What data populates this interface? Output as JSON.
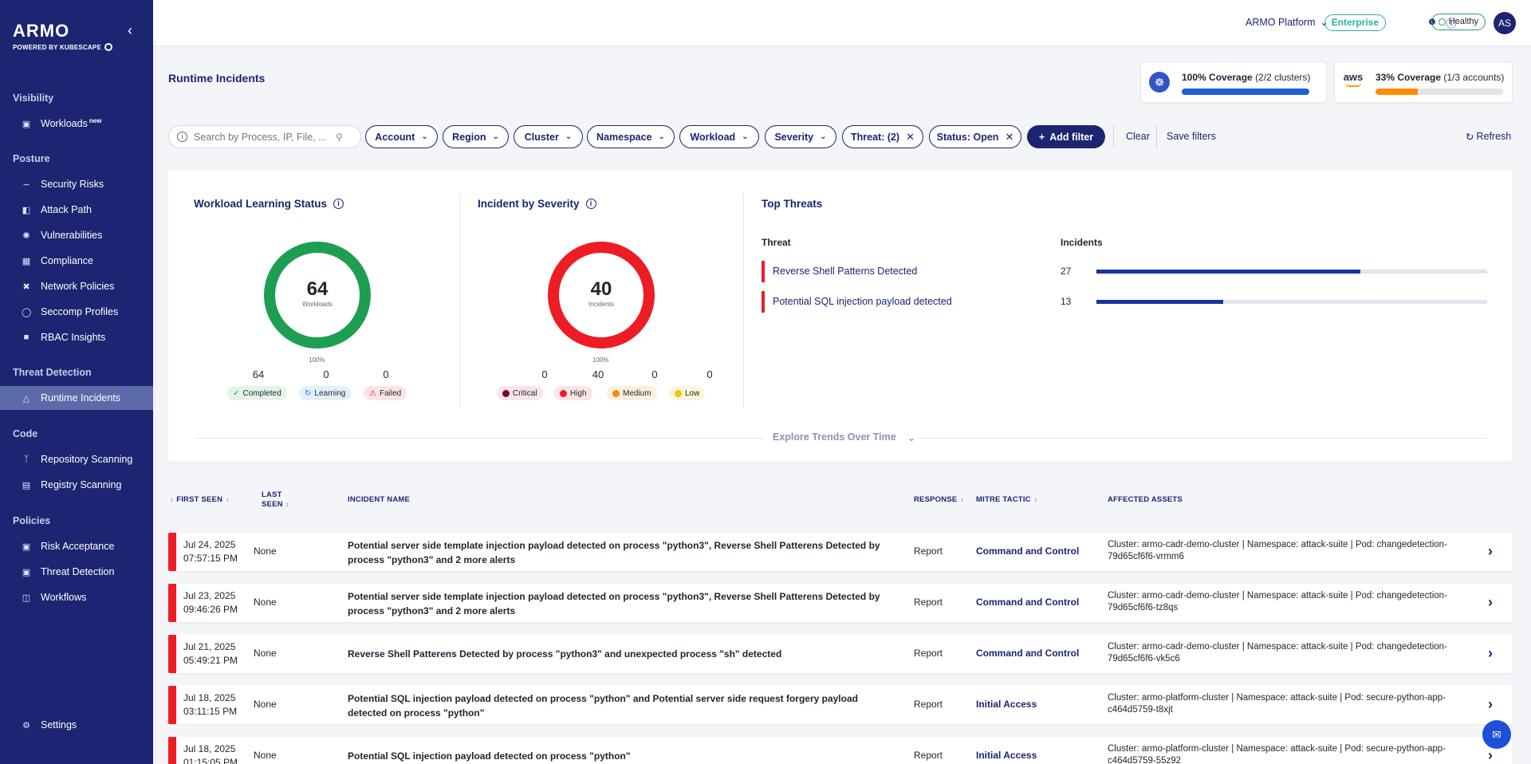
{
  "brand": {
    "name": "ARMO",
    "tagline": "POWERED BY KUBESCAPE"
  },
  "sidebar": {
    "sections": [
      {
        "title": "Visibility"
      },
      {
        "title": "Posture"
      },
      {
        "title": "Threat Detection"
      },
      {
        "title": "Code"
      },
      {
        "title": "Policies"
      }
    ],
    "items": [
      {
        "label": "Workloads",
        "badge": "new",
        "icon": "workloads-icon"
      },
      {
        "label": "Security Risks",
        "icon": "trend-icon"
      },
      {
        "label": "Attack Path",
        "icon": "path-icon"
      },
      {
        "label": "Vulnerabilities",
        "icon": "bug-icon"
      },
      {
        "label": "Compliance",
        "icon": "compliance-icon"
      },
      {
        "label": "Network Policies",
        "icon": "network-icon"
      },
      {
        "label": "Seccomp Profiles",
        "icon": "shield-icon"
      },
      {
        "label": "RBAC Insights",
        "icon": "rbac-icon"
      },
      {
        "label": "Runtime Incidents",
        "icon": "warning-icon",
        "active": true
      },
      {
        "label": "Repository Scanning",
        "icon": "branch-icon"
      },
      {
        "label": "Registry Scanning",
        "icon": "registry-icon"
      },
      {
        "label": "Risk Acceptance",
        "icon": "risk-icon"
      },
      {
        "label": "Threat Detection",
        "icon": "threat-icon"
      },
      {
        "label": "Workflows",
        "icon": "workflow-icon"
      },
      {
        "label": "Settings",
        "icon": "gear-icon"
      }
    ]
  },
  "topbar": {
    "platform": "ARMO Platform",
    "plan": "Enterprise",
    "status": "Healthy",
    "avatar": "AS"
  },
  "page": {
    "title": "Runtime Incidents"
  },
  "coverage": [
    {
      "percent_text": "100% Coverage",
      "detail": "(2/2 clusters)",
      "value": 1.0,
      "color": "#1e5ed8"
    },
    {
      "percent_text": "33% Coverage",
      "detail": "(1/3 accounts)",
      "value": 0.33,
      "color": "#ff8c00"
    }
  ],
  "filters": {
    "search_placeholder": "Search by Process, IP, File, ...",
    "chips": [
      "Account",
      "Region",
      "Cluster",
      "Namespace",
      "Workload",
      "Severity"
    ],
    "active_chips": [
      "Threat: (2)",
      "Status: Open"
    ],
    "add_filter": "Add filter",
    "clear": "Clear",
    "save": "Save filters",
    "refresh": "Refresh"
  },
  "learning": {
    "title": "Workload Learning Status",
    "total": "64",
    "unit": "Workloads",
    "pct": "100%",
    "stats": [
      {
        "count": "64",
        "label": "Completed",
        "bg": "#e3f5e8",
        "icon": "check-icon"
      },
      {
        "count": "0",
        "label": "Learning",
        "bg": "#e2f0fb",
        "icon": "refresh-icon"
      },
      {
        "count": "0",
        "label": "Failed",
        "bg": "#fde4e4",
        "icon": "warning-icon"
      }
    ],
    "color": "#1e9e50"
  },
  "severity": {
    "title": "Incident by Severity",
    "total": "40",
    "unit": "Incidents",
    "pct": "100%",
    "stats": [
      {
        "count": "0",
        "label": "Critical",
        "bg": "#fbe4ea",
        "dot": "#7a0a2a"
      },
      {
        "count": "40",
        "label": "High",
        "bg": "#fde4e4",
        "dot": "#ee1c25"
      },
      {
        "count": "0",
        "label": "Medium",
        "bg": "#fdeedd",
        "dot": "#f08a1c"
      },
      {
        "count": "0",
        "label": "Low",
        "bg": "#fdf5d8",
        "dot": "#f2c10f"
      }
    ],
    "color": "#ee1c25"
  },
  "top_threats": {
    "title": "Top Threats",
    "col_threat": "Threat",
    "col_incidents": "Incidents",
    "rows": [
      {
        "name": "Reverse Shell Patterns Detected",
        "count": "27",
        "value": 27
      },
      {
        "name": "Potential SQL injection payload detected",
        "count": "13",
        "value": 13
      }
    ],
    "max": 40
  },
  "explore": "Explore Trends Over Time",
  "table": {
    "headers": {
      "first_seen": "FIRST SEEN",
      "last_seen": "LAST SEEN",
      "incident": "INCIDENT NAME",
      "response": "RESPONSE",
      "mitre": "MITRE TACTIC",
      "assets": "AFFECTED ASSETS"
    },
    "rows": [
      {
        "date": "Jul 24, 2025",
        "time": "07:57:15 PM",
        "last": "None",
        "incident": "Potential server side template injection payload detected on process \"python3\", Reverse Shell Patterens Detected by process \"python3\" and 2 more alerts",
        "response": "Report",
        "mitre": "Command and Control",
        "assets": "Cluster: armo-cadr-demo-cluster | Namespace: attack-suite | Pod: changedetection-79d65cf6f6-vrmm6"
      },
      {
        "date": "Jul 23, 2025",
        "time": "09:46:26 PM",
        "last": "None",
        "incident": "Potential server side template injection payload detected on process \"python3\", Reverse Shell Patterens Detected by process \"python3\" and 2 more alerts",
        "response": "Report",
        "mitre": "Command and Control",
        "assets": "Cluster: armo-cadr-demo-cluster | Namespace: attack-suite | Pod: changedetection-79d65cf6f6-tz8qs"
      },
      {
        "date": "Jul 21, 2025",
        "time": "05:49:21 PM",
        "last": "None",
        "incident": "Reverse Shell Patterens Detected by process \"python3\" and unexpected process \"sh\" detected",
        "response": "Report",
        "mitre": "Command and Control",
        "assets": "Cluster: armo-cadr-demo-cluster | Namespace: attack-suite | Pod: changedetection-79d65cf6f6-vk5c6"
      },
      {
        "date": "Jul 18, 2025",
        "time": "03:11:15 PM",
        "last": "None",
        "incident": "Potential SQL injection payload detected on process \"python\" and Potential server side request forgery payload detected on process \"python\"",
        "response": "Report",
        "mitre": "Initial Access",
        "assets": "Cluster: armo-platform-cluster | Namespace: attack-suite | Pod: secure-python-app-c464d5759-t8xjt"
      },
      {
        "date": "Jul 18, 2025",
        "time": "01:15:05 PM",
        "last": "None",
        "incident": "Potential SQL injection payload detected on process \"python\"",
        "response": "Report",
        "mitre": "Initial Access",
        "assets": "Cluster: armo-platform-cluster | Namespace: attack-suite | Pod: secure-python-app-c464d5759-55z92"
      }
    ]
  }
}
